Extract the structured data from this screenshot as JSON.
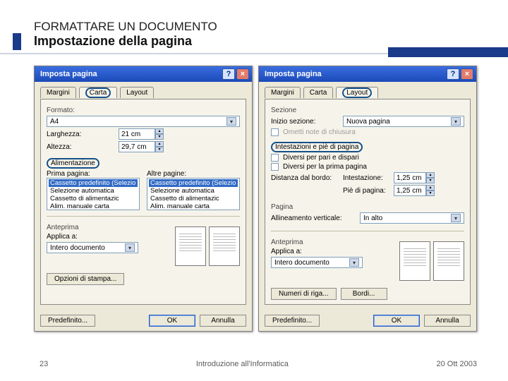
{
  "slide": {
    "title": "FORMATTARE UN DOCUMENTO",
    "subtitle": "Impostazione della pagina",
    "num": "23",
    "footer_center": "Introduzione all'Informatica",
    "footer_right": "20 Ott 2003"
  },
  "dlgA": {
    "title": "Imposta pagina",
    "tabs": {
      "margini": "Margini",
      "carta": "Carta",
      "layout": "Layout"
    },
    "format_label": "Formato:",
    "format_value": "A4",
    "width_label": "Larghezza:",
    "width_value": "21 cm",
    "height_label": "Altezza:",
    "height_value": "29,7 cm",
    "feed_label": "Alimentazione",
    "first_label": "Prima pagina:",
    "other_label": "Altre pagine:",
    "tray_items": [
      "Cassetto predefinito (Selezio",
      "Selezione automatica",
      "Cassetto di alimentazic",
      "Alim. manuale carta"
    ],
    "preview_label": "Anteprima",
    "apply_label": "Applica a:",
    "apply_value": "Intero documento",
    "print_btn": "Opzioni di stampa...",
    "default_btn": "Predefinito...",
    "ok": "OK",
    "cancel": "Annulla"
  },
  "dlgB": {
    "title": "Imposta pagina",
    "tabs": {
      "margini": "Margini",
      "carta": "Carta",
      "layout": "Layout"
    },
    "section_label": "Sezione",
    "section_start": "Inizio sezione:",
    "section_value": "Nuova pagina",
    "suppress": "Ometti note di chiusura",
    "hf_label": "Intestazioni e piè di pagina",
    "diff_oddeven": "Diversi per pari e dispari",
    "diff_first": "Diversi per la prima pagina",
    "from_edge": "Distanza dal bordo:",
    "header_label": "Intestazione:",
    "header_value": "1,25 cm",
    "footer_label": "Piè di pagina:",
    "footer_value": "1,25 cm",
    "page_label": "Pagina",
    "valign_label": "Allineamento verticale:",
    "valign_value": "In alto",
    "preview_label": "Anteprima",
    "apply_label": "Applica a:",
    "apply_value": "Intero documento",
    "linenum_btn": "Numeri di riga...",
    "borders_btn": "Bordi...",
    "default_btn": "Predefinito...",
    "ok": "OK",
    "cancel": "Annulla"
  }
}
